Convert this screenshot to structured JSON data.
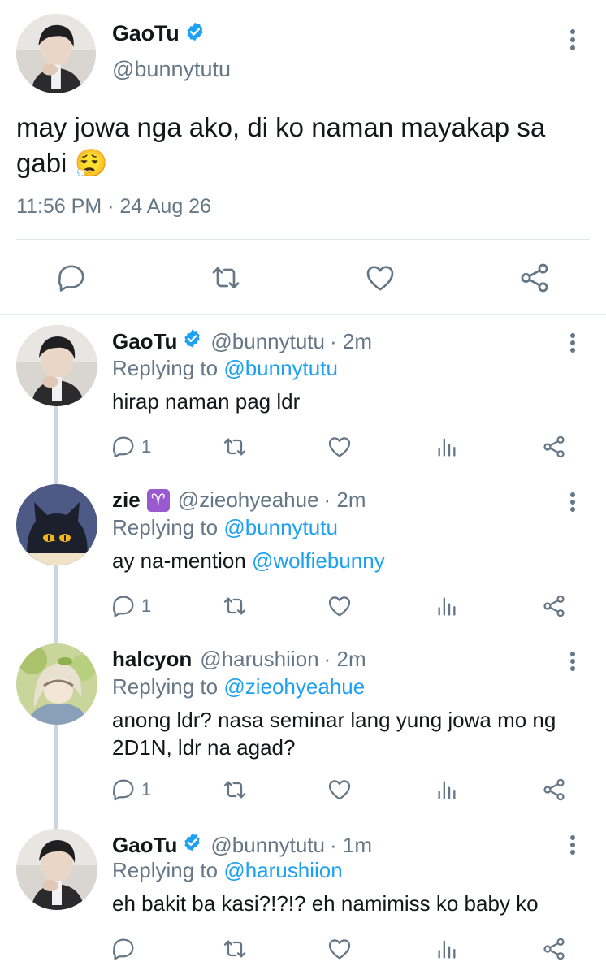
{
  "colors": {
    "link": "#1da1f2",
    "muted": "#657786",
    "verified": "#1da1f2",
    "divider": "#e6ecf0"
  },
  "main_tweet": {
    "name": "GaoTu",
    "handle": "@bunnytutu",
    "text": "may jowa nga ako, di ko naman mayakap sa gabi 😮‍💨",
    "timestamp": "11:56 PM · 24 Aug 26",
    "actions": [
      "reply-icon",
      "retweet-icon",
      "like-icon",
      "share-icon"
    ]
  },
  "replies": [
    {
      "name": "GaoTu",
      "verified": true,
      "handle": "@bunnytutu",
      "time": "· 2m",
      "replying_prefix": "Replying to",
      "replying_to": "@bunnytutu",
      "text": "hirap naman pag ldr",
      "mention": "",
      "reply_count": "1"
    },
    {
      "name": "zie",
      "zodiac": "♈",
      "handle": "@zieohyeahue",
      "time": "· 2m",
      "replying_prefix": "Replying to",
      "replying_to": "@bunnytutu",
      "text": "ay na-mention",
      "mention": "@wolfiebunny",
      "reply_count": "1"
    },
    {
      "name": "halcyon",
      "handle": "@harushiion",
      "time": "· 2m",
      "replying_prefix": "Replying to",
      "replying_to": "@zieohyeahue",
      "text": "anong ldr? nasa seminar lang yung jowa mo ng 2D1N, ldr na agad?",
      "mention": "",
      "reply_count": "1"
    },
    {
      "name": "GaoTu",
      "verified": true,
      "handle": "@bunnytutu",
      "time": "· 1m",
      "replying_prefix": "Replying to",
      "replying_to": "@harushiion",
      "text": "eh bakit ba kasi?!?!? eh namimiss ko baby ko",
      "mention": "",
      "reply_count": ""
    }
  ]
}
